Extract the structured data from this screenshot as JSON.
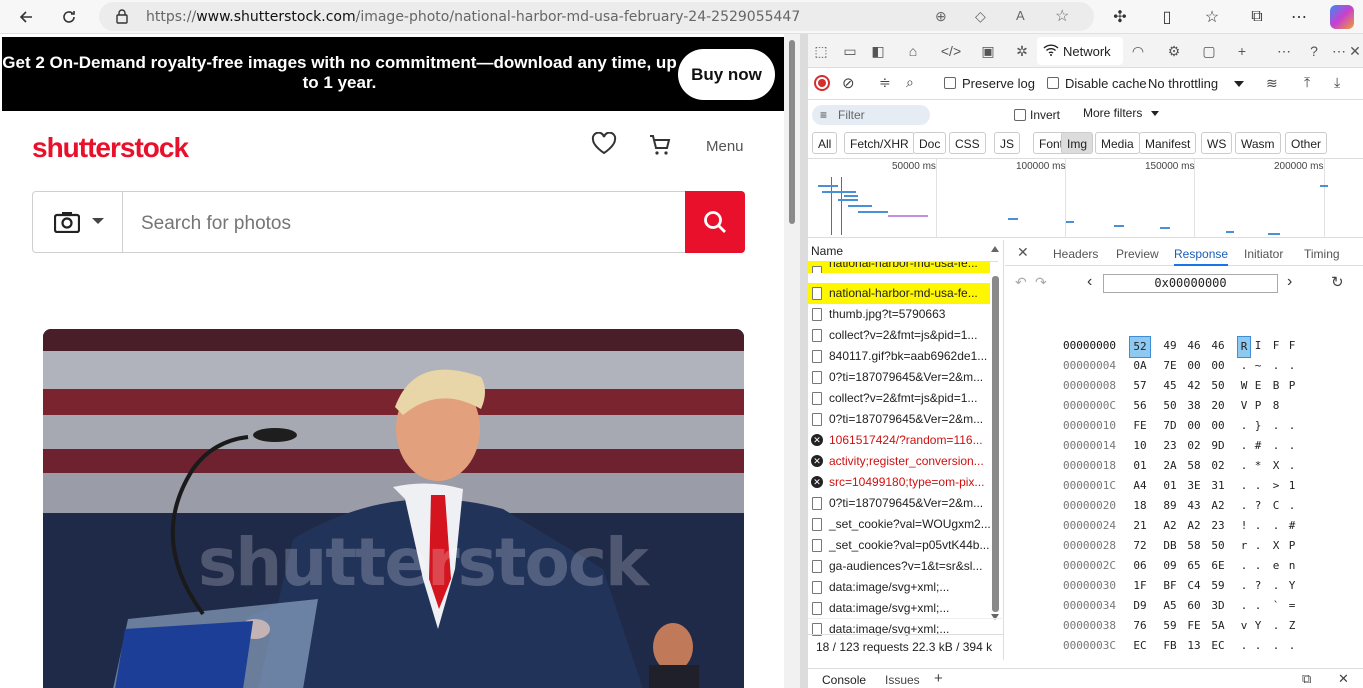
{
  "browser": {
    "url_prefix": "https://",
    "url_domain": "www.shutterstock.com",
    "url_path": "/image-photo/national-harbor-md-usa-february-24-2529055447"
  },
  "page": {
    "promo_text": "Get 2 On-Demand royalty-free images with no commitment—download any time, up to 1 year.",
    "buy_label": "Buy now",
    "logo": "shutterstock",
    "menu_label": "Menu",
    "search_placeholder": "Search for photos",
    "watermark": "shutterstock"
  },
  "devtools": {
    "network_tab": "Network",
    "preserve_log": "Preserve log",
    "disable_cache": "Disable cache",
    "throttling": "No throttling",
    "filter_placeholder": "Filter",
    "invert": "Invert",
    "more_filters": "More filters",
    "type_filters": [
      "All",
      "Fetch/XHR",
      "Doc",
      "CSS",
      "JS",
      "Font",
      "Img",
      "Media",
      "Manifest",
      "WS",
      "Wasm",
      "Other"
    ],
    "active_filter": "Img",
    "timeline_ticks": [
      "50000 ms",
      "100000 ms",
      "150000 ms",
      "200000 ms"
    ],
    "name_header": "Name",
    "requests": [
      {
        "name": "national-harbor-md-usa-fe...",
        "status": "ok",
        "highlighted": true
      },
      {
        "name": "national-harbor-md-usa-fe...",
        "status": "ok",
        "highlighted": true
      },
      {
        "name": "thumb.jpg?t=5790663",
        "status": "ok"
      },
      {
        "name": "collect?v=2&fmt=js&pid=1...",
        "status": "ok"
      },
      {
        "name": "840117.gif?bk=aab6962de1...",
        "status": "ok"
      },
      {
        "name": "0?ti=187079645&Ver=2&m...",
        "status": "ok"
      },
      {
        "name": "collect?v=2&fmt=js&pid=1...",
        "status": "ok"
      },
      {
        "name": "0?ti=187079645&Ver=2&m...",
        "status": "ok"
      },
      {
        "name": "1061517424/?random=116...",
        "status": "error"
      },
      {
        "name": "activity;register_conversion...",
        "status": "error"
      },
      {
        "name": "src=10499180;type=om-pix...",
        "status": "error"
      },
      {
        "name": "0?ti=187079645&Ver=2&m...",
        "status": "ok"
      },
      {
        "name": "_set_cookie?val=WOUgxm2...",
        "status": "ok"
      },
      {
        "name": "_set_cookie?val=p05vtK44b...",
        "status": "ok"
      },
      {
        "name": "ga-audiences?v=1&t=sr&sl...",
        "status": "ok"
      },
      {
        "name": "data:image/svg+xml;...",
        "status": "ok"
      },
      {
        "name": "data:image/svg+xml;...",
        "status": "ok"
      },
      {
        "name": "data:image/svg+xml;...",
        "status": "ok"
      }
    ],
    "status_bar": "18 / 123 requests   22.3 kB / 394 k",
    "detail_tabs": [
      "Headers",
      "Preview",
      "Response",
      "Initiator",
      "Timing"
    ],
    "active_detail_tab": "Response",
    "hex_offset": "0x00000000",
    "hex_rows": [
      {
        "addr": "00000000",
        "bytes": [
          "52",
          "49",
          "46",
          "46"
        ],
        "chars": [
          "R",
          "I",
          "F",
          "F"
        ]
      },
      {
        "addr": "00000004",
        "bytes": [
          "0A",
          "7E",
          "00",
          "00"
        ],
        "chars": [
          ".",
          "~",
          ".",
          "."
        ]
      },
      {
        "addr": "00000008",
        "bytes": [
          "57",
          "45",
          "42",
          "50"
        ],
        "chars": [
          "W",
          "E",
          "B",
          "P"
        ]
      },
      {
        "addr": "0000000C",
        "bytes": [
          "56",
          "50",
          "38",
          "20"
        ],
        "chars": [
          "V",
          "P",
          "8",
          ""
        ]
      },
      {
        "addr": "00000010",
        "bytes": [
          "FE",
          "7D",
          "00",
          "00"
        ],
        "chars": [
          ".",
          "}",
          ".",
          "."
        ]
      },
      {
        "addr": "00000014",
        "bytes": [
          "10",
          "23",
          "02",
          "9D"
        ],
        "chars": [
          ".",
          "#",
          ".",
          "."
        ]
      },
      {
        "addr": "00000018",
        "bytes": [
          "01",
          "2A",
          "58",
          "02"
        ],
        "chars": [
          ".",
          "*",
          "X",
          "."
        ]
      },
      {
        "addr": "0000001C",
        "bytes": [
          "A4",
          "01",
          "3E",
          "31"
        ],
        "chars": [
          ".",
          ".",
          ">",
          "1"
        ]
      },
      {
        "addr": "00000020",
        "bytes": [
          "18",
          "89",
          "43",
          "A2"
        ],
        "chars": [
          ".",
          "?",
          "C",
          "."
        ]
      },
      {
        "addr": "00000024",
        "bytes": [
          "21",
          "A2",
          "A2",
          "23"
        ],
        "chars": [
          "!",
          ".",
          ".",
          "#"
        ]
      },
      {
        "addr": "00000028",
        "bytes": [
          "72",
          "DB",
          "58",
          "50"
        ],
        "chars": [
          "r",
          ".",
          "X",
          "P"
        ]
      },
      {
        "addr": "0000002C",
        "bytes": [
          "06",
          "09",
          "65",
          "6E"
        ],
        "chars": [
          ".",
          ".",
          "e",
          "n"
        ]
      },
      {
        "addr": "00000030",
        "bytes": [
          "1F",
          "BF",
          "C4",
          "59"
        ],
        "chars": [
          ".",
          "?",
          ".",
          "Y"
        ]
      },
      {
        "addr": "00000034",
        "bytes": [
          "D9",
          "A5",
          "60",
          "3D"
        ],
        "chars": [
          ".",
          ".",
          "`",
          "="
        ]
      },
      {
        "addr": "00000038",
        "bytes": [
          "76",
          "59",
          "FE",
          "5A"
        ],
        "chars": [
          "v",
          "Y",
          ".",
          "Z"
        ]
      },
      {
        "addr": "0000003C",
        "bytes": [
          "EC",
          "FB",
          "13",
          "EC"
        ],
        "chars": [
          ".",
          ".",
          ".",
          "."
        ]
      }
    ],
    "drawer_tabs": [
      "Console",
      "Issues"
    ]
  }
}
